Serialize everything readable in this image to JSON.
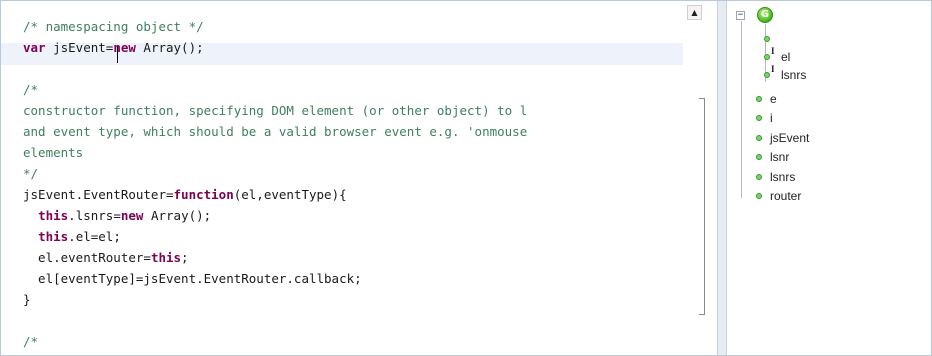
{
  "editor": {
    "lines": [
      [
        {
          "t": "comment",
          "s": "/* namespacing object */"
        }
      ],
      [
        {
          "t": "keyword",
          "s": "var"
        },
        {
          "t": "plain",
          "s": " jsEvent="
        },
        {
          "t": "keyword",
          "s": "new"
        },
        {
          "t": "plain",
          "s": " Array();"
        }
      ],
      [
        {
          "t": "plain",
          "s": ""
        }
      ],
      [
        {
          "t": "comment",
          "s": "/*"
        }
      ],
      [
        {
          "t": "comment",
          "s": "constructor function, specifying DOM element (or other object) to l"
        }
      ],
      [
        {
          "t": "comment",
          "s": "and event type, which should be a valid browser event e.g. 'onmouse"
        }
      ],
      [
        {
          "t": "comment",
          "s": "elements"
        }
      ],
      [
        {
          "t": "comment",
          "s": "*/"
        }
      ],
      [
        {
          "t": "plain",
          "s": "jsEvent.EventRouter="
        },
        {
          "t": "keyword",
          "s": "function"
        },
        {
          "t": "plain",
          "s": "(el,eventType){"
        }
      ],
      [
        {
          "t": "plain",
          "s": "  "
        },
        {
          "t": "keyword",
          "s": "this"
        },
        {
          "t": "plain",
          "s": ".lsnrs="
        },
        {
          "t": "keyword",
          "s": "new"
        },
        {
          "t": "plain",
          "s": " Array();"
        }
      ],
      [
        {
          "t": "plain",
          "s": "  "
        },
        {
          "t": "keyword",
          "s": "this"
        },
        {
          "t": "plain",
          "s": ".el=el;"
        }
      ],
      [
        {
          "t": "plain",
          "s": "  el.eventRouter="
        },
        {
          "t": "keyword",
          "s": "this"
        },
        {
          "t": "plain",
          "s": ";"
        }
      ],
      [
        {
          "t": "plain",
          "s": "  el[eventType]=jsEvent.EventRouter.callback;"
        }
      ],
      [
        {
          "t": "plain",
          "s": "}"
        }
      ],
      [
        {
          "t": "plain",
          "s": ""
        }
      ],
      [
        {
          "t": "comment",
          "s": "/*"
        }
      ]
    ],
    "scroll_up_glyph": "▲"
  },
  "outline": {
    "collapse_glyph": "−",
    "root_icon_letter": "G",
    "children": [
      {
        "label": ""
      },
      {
        "label": "el",
        "inherited": "I"
      },
      {
        "label": "lsnrs",
        "inherited": "I"
      }
    ],
    "items": [
      {
        "label": "e"
      },
      {
        "label": "i"
      },
      {
        "label": "jsEvent"
      },
      {
        "label": "lsnr"
      },
      {
        "label": "lsnrs"
      },
      {
        "label": "router"
      }
    ]
  },
  "colors": {
    "comment": "#3f7f5f",
    "keyword": "#7f0055",
    "current_line": "#eef3fb",
    "node_icon": "#43b81c"
  }
}
